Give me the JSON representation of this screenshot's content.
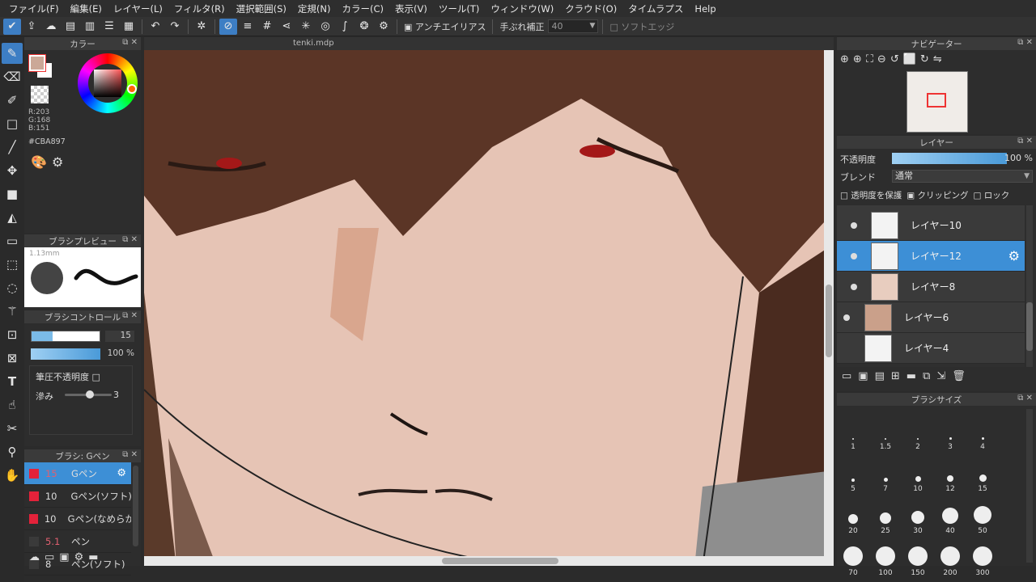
{
  "menu": [
    "ファイル(F)",
    "編集(E)",
    "レイヤー(L)",
    "フィルタ(R)",
    "選択範囲(S)",
    "定規(N)",
    "カラー(C)",
    "表示(V)",
    "ツール(T)",
    "ウィンドウ(W)",
    "クラウド(O)",
    "タイムラプス",
    "Help"
  ],
  "toolbar": {
    "antialias": "アンチエイリアス",
    "stabilizer_label": "手ぶれ補正",
    "stabilizer_value": "40",
    "soft_edge": "ソフトエッジ"
  },
  "color_panel": {
    "title": "カラー",
    "r": "R:203",
    "g": "G:168",
    "b": "B:151",
    "hex": "#CBA897",
    "fg_color": "#CBA897"
  },
  "brush_preview": {
    "title": "ブラシプレビュー",
    "size": "1.13mm"
  },
  "brush_control": {
    "title": "ブラシコントロール",
    "size_value": "15",
    "opacity_value": "100 %",
    "pressure_opacity": "筆圧不透明度",
    "blur_label": "滲み",
    "blur_value": "3"
  },
  "brush_list": {
    "title": "ブラシ: Gペン",
    "items": [
      {
        "size": "15",
        "name": "Gペン",
        "color": "#e3223a",
        "selected": true
      },
      {
        "size": "10",
        "name": "Gペン(ソフト)",
        "color": "#e3223a"
      },
      {
        "size": "10",
        "name": "Gペン(なめらか)",
        "color": "#e3223a"
      },
      {
        "size": "5.1",
        "name": "ペン",
        "color": "#3a3a3a"
      },
      {
        "size": "8",
        "name": "ペン(ソフト)",
        "color": "#3a3a3a"
      }
    ]
  },
  "document": {
    "tab": "tenki.mdp"
  },
  "navigator": {
    "title": "ナビゲーター"
  },
  "layer_panel": {
    "title": "レイヤー",
    "opacity_label": "不透明度",
    "opacity_value": "100 %",
    "opacity_fraction": 1.0,
    "blend_label": "ブレンド",
    "blend_value": "通常",
    "protect_alpha": "透明度を保護",
    "clipping": "クリッピング",
    "lock": "ロック",
    "layers": [
      {
        "name": "レイヤー10"
      },
      {
        "name": "レイヤー12",
        "selected": true
      },
      {
        "name": "レイヤー8"
      },
      {
        "name": "レイヤー6"
      },
      {
        "name": "レイヤー4"
      }
    ]
  },
  "brush_size_panel": {
    "title": "ブラシサイズ",
    "sizes": [
      "1",
      "1.5",
      "2",
      "3",
      "4",
      "5",
      "7",
      "10",
      "12",
      "15",
      "20",
      "25",
      "30",
      "40",
      "50",
      "70",
      "100",
      "150",
      "200",
      "300"
    ]
  },
  "colors": {
    "accent": "#3d7ec4",
    "selected_layer": "#3d8fd6"
  }
}
